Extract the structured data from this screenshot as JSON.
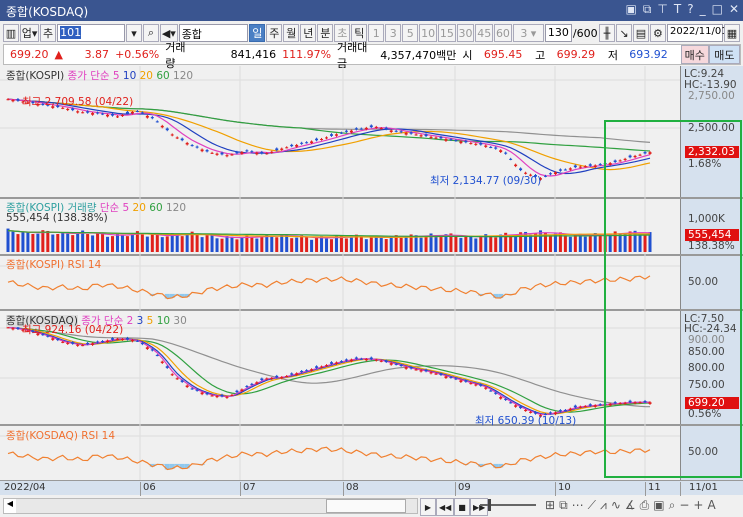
{
  "window": {
    "title": "종합(KOSDAQ)",
    "icons": [
      "restore-icon",
      "copy-icon",
      "pin-icon",
      "text-icon",
      "help-icon",
      "minimize-icon",
      "maximize-icon",
      "close-icon"
    ]
  },
  "toolbar": {
    "market": "업",
    "add": "추",
    "code": "101",
    "name": "종합(KOSDAQ)",
    "periods": [
      "일",
      "주",
      "월",
      "년",
      "분",
      "초",
      "틱"
    ],
    "minutes": [
      "1",
      "3",
      "5",
      "10",
      "15",
      "30",
      "45",
      "60"
    ],
    "n_select": "3",
    "count": "130",
    "total": "/600",
    "date": "2022/11/01"
  },
  "quote": {
    "price": "699.20",
    "arrow": "▲",
    "change": "3.87",
    "pct": "+0.56%",
    "vol_label": "거래량",
    "volume": "841,416",
    "vol_pct": "111.97%",
    "amt_label": "거래대금",
    "amount": "4,357,470백만",
    "open_label": "시",
    "open": "695.45",
    "high_label": "고",
    "high": "699.29",
    "low_label": "저",
    "low": "693.92",
    "buy": "매수",
    "sell": "매도"
  },
  "colors": {
    "up": "#e0201c",
    "down": "#2050d0",
    "ma5": "#e040c0",
    "ma10": "#2040c0",
    "ma20": "#f0a000",
    "ma60": "#30a040",
    "ma120": "#909090",
    "highlight": "#20b040"
  },
  "panels": {
    "kospi": {
      "title": "종합(KOSPI)",
      "ma_label": "종가 단순",
      "ma": [
        "5",
        "10",
        "20",
        "60",
        "120"
      ],
      "high_note": "최고 2,709.58 (04/22)",
      "low_note": "최저 2,134.77 (09/30)",
      "lc": "LC:9.24",
      "hc": "HC:-13.90",
      "ticks": [
        "2,750.00",
        "2,500.00"
      ],
      "last": "2,332.03",
      "last_pct": "1.68%"
    },
    "volume": {
      "title": "종합(KOSPI) 거래량",
      "ma_label": "단순",
      "ma": [
        "5",
        "20",
        "60",
        "120"
      ],
      "note": "555,454 (138.38%)",
      "tick": "1,000K",
      "last": "555,454",
      "last_pct": "138.38%"
    },
    "kospi_rsi": {
      "title": "종합(KOSPI) RSI 14",
      "tick": "50.00"
    },
    "kosdaq": {
      "title": "종합(KOSDAQ)",
      "ma_label": "종가 단순",
      "ma": [
        "2",
        "3",
        "5",
        "10",
        "30"
      ],
      "high_note": "최고 924.16 (04/22)",
      "low_note": "최저 650.39 (10/13)",
      "lc": "LC:7.50",
      "hc": "HC:-24.34",
      "ticks": [
        "900.00",
        "850.00",
        "800.00",
        "750.00"
      ],
      "last": "699.20",
      "last_pct": "0.56%"
    },
    "kosdaq_rsi": {
      "title": "종합(KOSDAQ) RSI 14",
      "tick": "50.00"
    }
  },
  "dates": [
    "2022/04",
    "06",
    "07",
    "08",
    "09",
    "10",
    "11",
    "11/01"
  ],
  "chart_data": {
    "type": "candlestick",
    "kospi_close": [
      2700,
      2680,
      2660,
      2640,
      2610,
      2600,
      2580,
      2620,
      2560,
      2450,
      2380,
      2330,
      2310,
      2340,
      2320,
      2360,
      2390,
      2420,
      2460,
      2490,
      2510,
      2480,
      2460,
      2440,
      2420,
      2400,
      2380,
      2340,
      2200,
      2150,
      2200,
      2230,
      2240,
      2260,
      2300,
      2332
    ],
    "kosdaq_close": [
      924,
      915,
      900,
      880,
      870,
      880,
      890,
      885,
      850,
      780,
      740,
      720,
      715,
      745,
      770,
      775,
      790,
      805,
      820,
      830,
      828,
      815,
      800,
      790,
      775,
      760,
      745,
      710,
      680,
      660,
      670,
      685,
      690,
      695,
      699,
      699
    ],
    "volume_k": [
      650,
      560,
      620,
      540,
      600,
      520,
      500,
      580,
      480,
      520,
      560,
      470,
      430,
      450,
      480,
      500,
      440,
      420,
      450,
      470,
      430,
      460,
      480,
      500,
      520,
      450,
      480,
      520,
      560,
      600,
      540,
      500,
      520,
      560,
      600,
      555
    ],
    "kospi_rsi": [
      55,
      48,
      42,
      45,
      40,
      50,
      46,
      38,
      30,
      22,
      28,
      40,
      45,
      50,
      48,
      55,
      58,
      60,
      62,
      58,
      52,
      48,
      45,
      42,
      38,
      35,
      30,
      22,
      40,
      48,
      52,
      55,
      58,
      60,
      62,
      68
    ],
    "kosdaq_rsi": [
      52,
      46,
      40,
      44,
      38,
      48,
      44,
      36,
      28,
      20,
      25,
      38,
      45,
      52,
      50,
      56,
      58,
      62,
      60,
      55,
      50,
      46,
      44,
      40,
      36,
      32,
      28,
      24,
      38,
      44,
      50,
      52,
      56,
      55,
      58,
      60
    ]
  }
}
